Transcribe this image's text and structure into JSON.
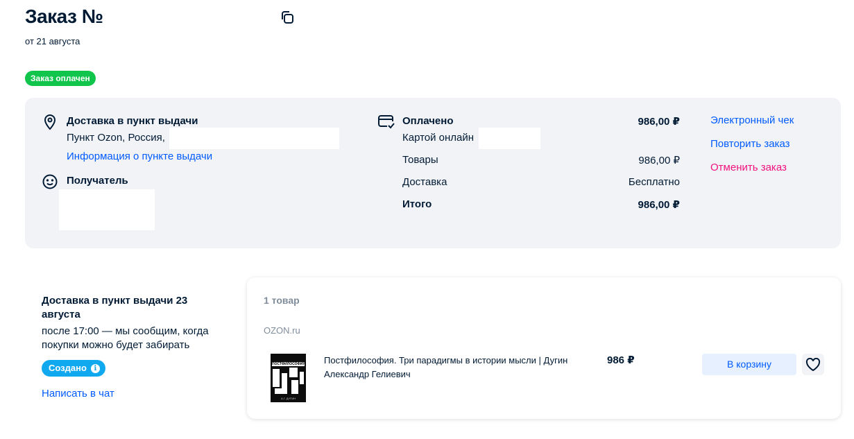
{
  "header": {
    "title": "Заказ №",
    "date": "от 21 августа",
    "status_badge": "Заказ оплачен"
  },
  "delivery_info": {
    "heading": "Доставка в пункт выдачи",
    "address_prefix": "Пункт Ozon, Россия,",
    "pickup_info_link": "Информация о пункте выдачи",
    "recipient_heading": "Получатель"
  },
  "payment": {
    "heading": "Оплачено",
    "heading_amount": "986,00 ₽",
    "method": "Картой онлайн",
    "rows": [
      {
        "label": "Товары",
        "value": "986,00 ₽"
      },
      {
        "label": "Доставка",
        "value": "Бесплатно"
      }
    ],
    "total_label": "Итого",
    "total_value": "986,00 ₽"
  },
  "actions": {
    "receipt": "Электронный чек",
    "repeat": "Повторить заказ",
    "cancel": "Отменить заказ"
  },
  "shipment": {
    "title": "Доставка в пункт выдачи 23 августа",
    "note": "после 17:00 — мы сообщим, когда покупки можно будет забирать",
    "status_badge": "Создано",
    "chat_link": "Написать в чат"
  },
  "order_card": {
    "count": "1 товар",
    "seller": "OZON.ru",
    "item": {
      "name": "Постфилософия. Три парадигмы в истории мысли | Дугин Александр Гелиевич",
      "price": "986 ₽",
      "cover_text": "ПОСТФИЛОСОФИЯ",
      "cover_author": "А.Г. ДУГИН"
    },
    "cart_button": "В корзину"
  },
  "colors": {
    "brand_blue": "#005bff",
    "paid_green": "#10c44c",
    "created_blue": "#10a9f0",
    "cancel_red": "#f1117e",
    "panel_bg": "#f2f3f7",
    "text_dark": "#001a34"
  },
  "icons": [
    "copy-icon",
    "location-pin-icon",
    "smiley-icon",
    "card-check-icon",
    "info-icon",
    "heart-icon"
  ]
}
